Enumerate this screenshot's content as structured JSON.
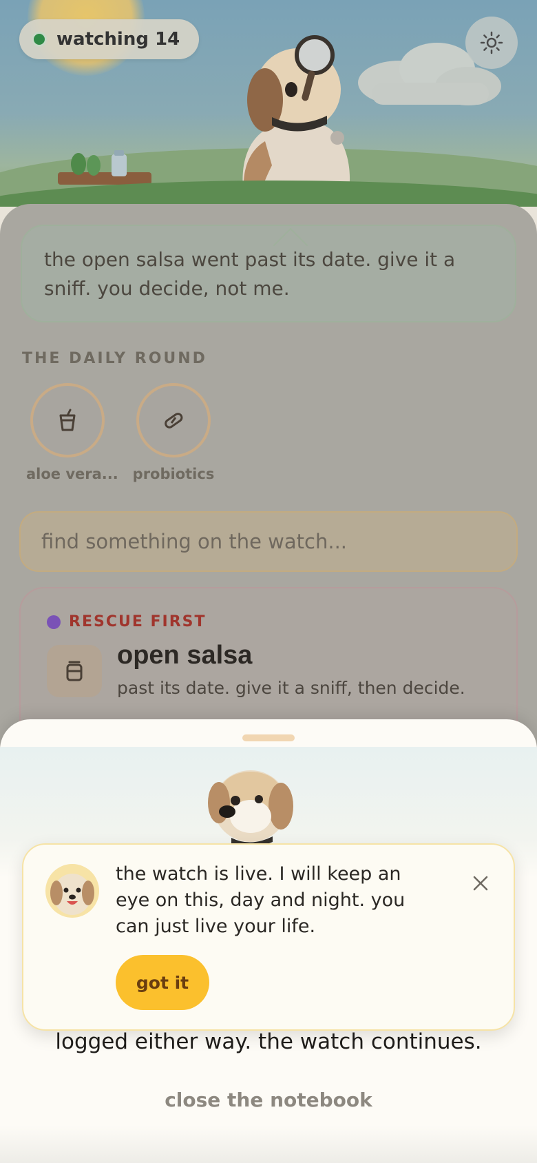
{
  "status": {
    "watching_label": "watching 14",
    "dot_color": "#2f8a46"
  },
  "settings": {
    "icon": "sun-settings-icon"
  },
  "message": {
    "text": "the open salsa went past its date. give it a sniff. you decide, not me."
  },
  "daily_round": {
    "title": "THE DAILY ROUND",
    "items": [
      {
        "label": "aloe vera...",
        "icon": "cup-icon"
      },
      {
        "label": "probiotics",
        "icon": "capsule-icon"
      }
    ]
  },
  "search": {
    "placeholder": "find something on the watch..."
  },
  "card": {
    "tag": "RESCUE FIRST",
    "tag_dot_color": "#7a52b6",
    "title": "open salsa",
    "subtitle": "past its date. give it a sniff, then decide.",
    "icon": "jar-icon"
  },
  "sheet": {
    "line": "logged either way. the watch continues.",
    "close_label": "close the notebook"
  },
  "toast": {
    "text": "the watch is live. I will keep an eye on this, day and night. you can just live your life.",
    "button_label": "got it",
    "button_color": "#fbc02d"
  }
}
